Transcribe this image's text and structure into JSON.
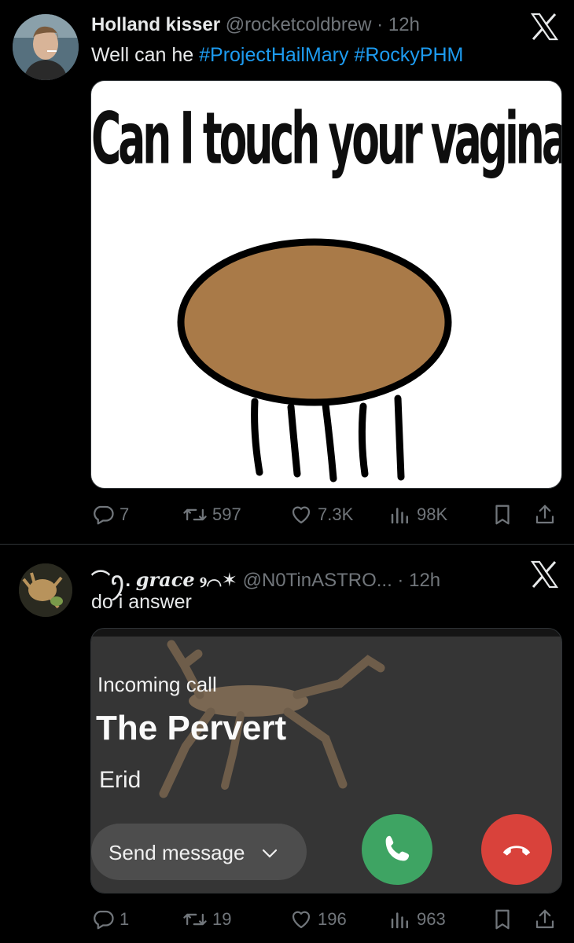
{
  "tweets": [
    {
      "display_name": "Holland kisser",
      "handle": "@rocketcoldbrew",
      "separator": "·",
      "time": "12h",
      "text": "Well can he",
      "hashtags": [
        "#ProjectHailMary",
        "#RockyPHM"
      ],
      "meme_caption": "Can I touch your vagina question",
      "stats": {
        "replies": "7",
        "reposts": "597",
        "likes": "7.3K",
        "views": "98K"
      }
    },
    {
      "display_name_decor": "⌒ꪆ.",
      "display_name": "grace",
      "display_name_suffix": "ⳋ⌒✶",
      "handle": "@N0TinASTRO...",
      "separator": "·",
      "time": "12h",
      "text": "do i answer",
      "call": {
        "label": "Incoming call",
        "caller": "The Pervert",
        "subtitle": "Erid",
        "send_message": "Send message"
      },
      "stats": {
        "replies": "1",
        "reposts": "19",
        "likes": "196",
        "views": "963"
      }
    }
  ],
  "colors": {
    "background": "#000000",
    "hashtag": "#1d9bf0",
    "muted": "#71767b",
    "answer": "#3ea463",
    "decline": "#d9423b",
    "rocky_body": "#a97a48"
  }
}
